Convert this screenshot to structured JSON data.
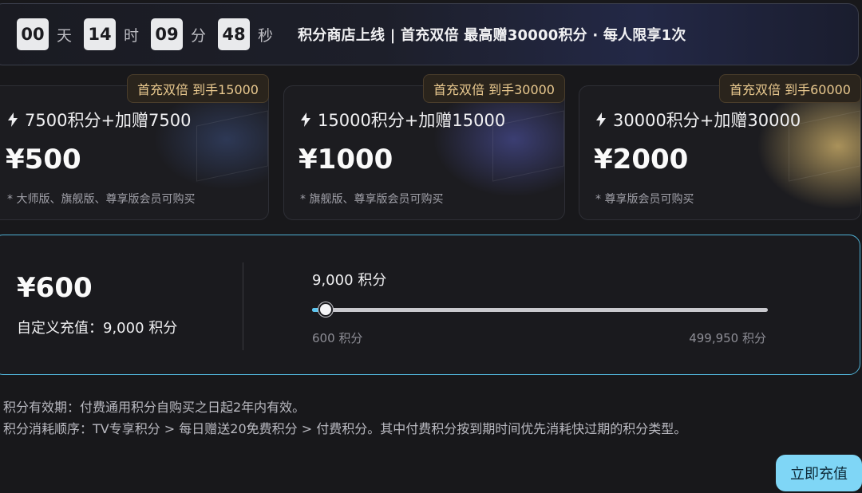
{
  "countdown": {
    "days": "00",
    "days_unit": "天",
    "hours": "14",
    "hours_unit": "时",
    "minutes": "09",
    "minutes_unit": "分",
    "seconds": "48",
    "seconds_unit": "秒"
  },
  "banner": {
    "text": "积分商店上线 | 首充双倍 最高赠30000积分 · 每人限享1次"
  },
  "packages": [
    {
      "badge": "首充双倍 到手15000",
      "name": "7500积分+加赠7500",
      "price": "¥500",
      "note": "* 大师版、旗舰版、尊享版会员可购买",
      "icon": "bolt-icon"
    },
    {
      "badge": "首充双倍 到手30000",
      "name": "15000积分+加赠15000",
      "price": "¥1000",
      "note": "* 旗舰版、尊享版会员可购买",
      "icon": "bolt-icon"
    },
    {
      "badge": "首充双倍 到手60000",
      "name": "30000积分+加赠30000",
      "price": "¥2000",
      "note": "* 尊享版会员可购买",
      "icon": "bolt-icon"
    }
  ],
  "custom": {
    "price": "¥600",
    "label": "自定义充值：9,000 积分",
    "amount": "9,000 积分",
    "min_label": "600 积分",
    "max_label": "499,950 积分",
    "slider_value": 9000,
    "slider_min": 600,
    "slider_max": 499950
  },
  "notes": [
    "积分有效期：付费通用积分自购买之日起2年内有效。",
    "积分消耗顺序：TV专享积分 > 每日赠送20免费积分 > 付费积分。其中付费积分按到期时间优先消耗快过期的积分类型。"
  ],
  "cta": {
    "label": "立即充值"
  },
  "colors": {
    "accent": "#5cc5ef",
    "cta_bg": "#7fd6f6",
    "badge_text": "#e9c98f"
  }
}
